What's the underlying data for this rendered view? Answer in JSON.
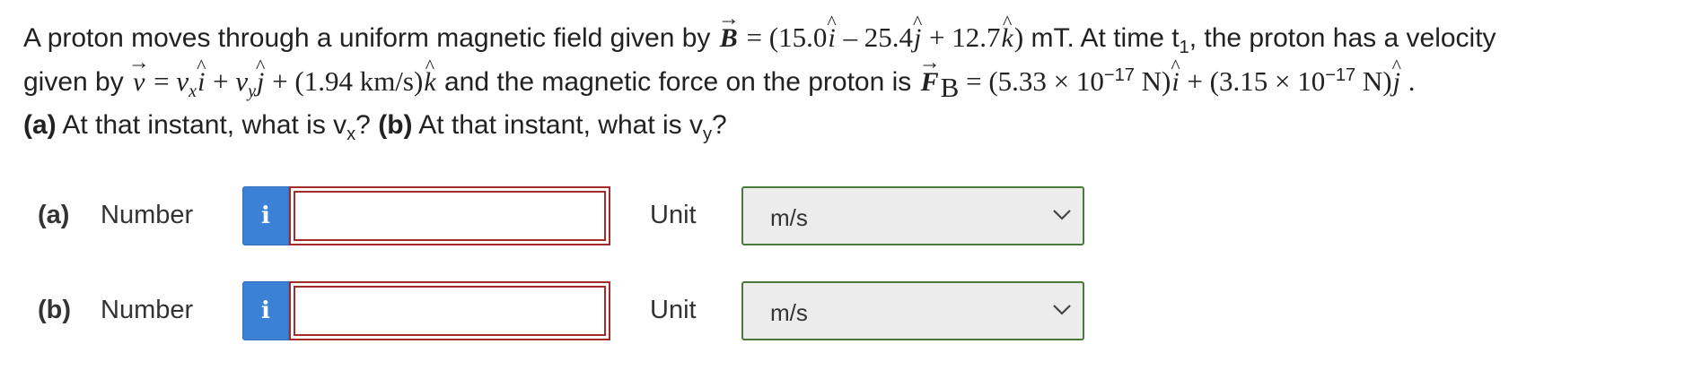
{
  "problem": {
    "l1_text1": "A proton moves through a uniform magnetic field given by",
    "l1_B": "B",
    "l1_eq": " = (15.0",
    "l1_i": "i",
    "l1_minus": " – 25.4",
    "l1_j": "j",
    "l1_plus": " + 12.7",
    "l1_k": "k",
    "l1_close": ")",
    "l1_text2": " mT. At time t",
    "l1_sub1": "1",
    "l1_text3": ", the proton has a velocity",
    "l2_text1": "given by",
    "l2_v": "v",
    "l2_eq": " = ",
    "l2_vx": "v",
    "l2_x": "x",
    "l2_i": "i",
    "l2_plus1": " + ",
    "l2_vy": "v",
    "l2_y": "y",
    "l2_j": "j",
    "l2_plus2": " + (1.94  km/s)",
    "l2_k": "k",
    "l2_text2": " and the magnetic force on the proton is",
    "l2_F": "F",
    "l2_Fsub": "B",
    "l2_eq2": " = (5.33 × 10",
    "l2_exp1": "−17",
    "l2_N1": " N)",
    "l2_i2": "i",
    "l2_plus3": " + (3.15 × 10",
    "l2_exp2": "−17",
    "l2_N2": " N)",
    "l2_j2": "j",
    "l2_end": " .",
    "l3_a": "(a)",
    "l3_text1": " At that instant, what is v",
    "l3_sub_x": "x",
    "l3_text2": "? ",
    "l3_b": "(b)",
    "l3_text3": " At that instant, what is v",
    "l3_sub_y": "y",
    "l3_text4": "?"
  },
  "answers": [
    {
      "part_label": "(a)",
      "number_label": "Number",
      "info_icon": "i",
      "number_value": "",
      "unit_label": "Unit",
      "unit_selected": "m/s"
    },
    {
      "part_label": "(b)",
      "number_label": "Number",
      "info_icon": "i",
      "number_value": "",
      "unit_label": "Unit",
      "unit_selected": "m/s"
    }
  ],
  "colors": {
    "info_button": "#3b82d6",
    "input_border": "#a52a2a",
    "select_border": "#4a7a3a",
    "select_bg": "#ececec"
  }
}
